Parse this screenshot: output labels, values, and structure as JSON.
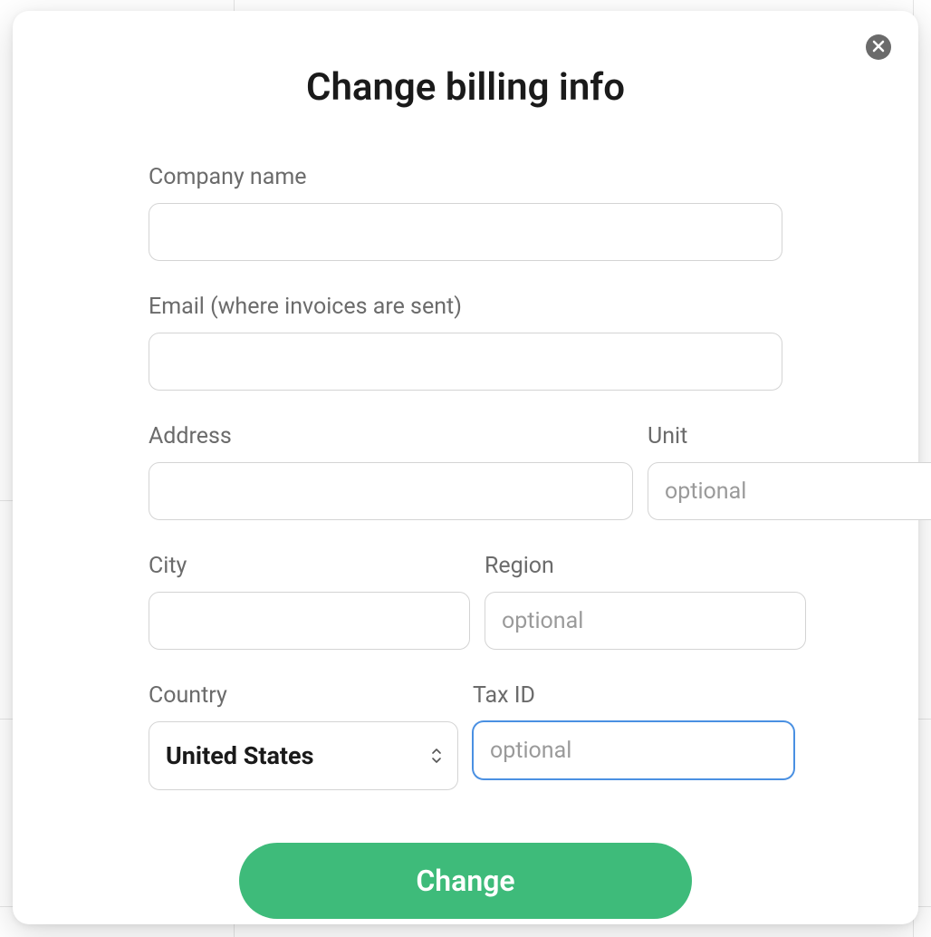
{
  "modal": {
    "title": "Change billing info",
    "fields": {
      "company": {
        "label": "Company name",
        "value": "",
        "placeholder": ""
      },
      "email": {
        "label": "Email (where invoices are sent)",
        "value": "",
        "placeholder": ""
      },
      "address": {
        "label": "Address",
        "value": "",
        "placeholder": ""
      },
      "unit": {
        "label": "Unit",
        "value": "",
        "placeholder": "optional"
      },
      "city": {
        "label": "City",
        "value": "",
        "placeholder": ""
      },
      "region": {
        "label": "Region",
        "value": "",
        "placeholder": "optional"
      },
      "country": {
        "label": "Country",
        "value": "United States"
      },
      "taxid": {
        "label": "Tax ID",
        "value": "",
        "placeholder": "optional"
      }
    },
    "submit_label": "Change"
  }
}
